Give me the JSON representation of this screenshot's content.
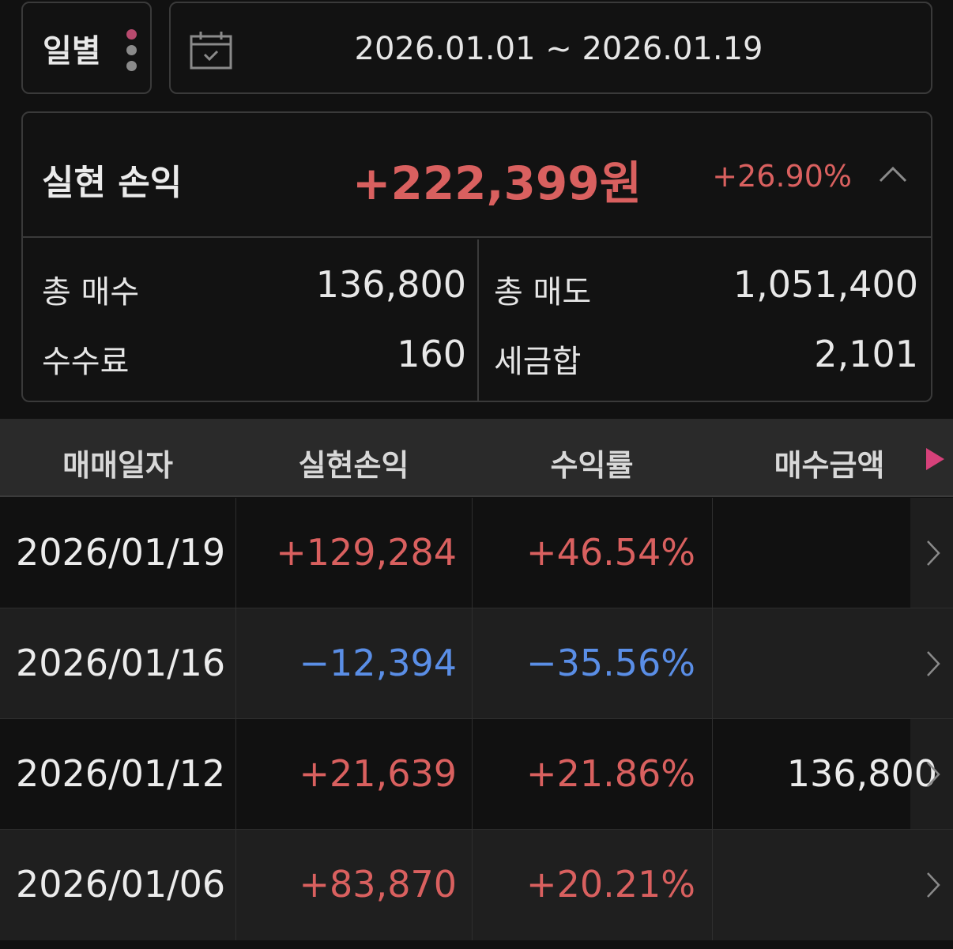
{
  "period": {
    "label": "일별"
  },
  "date_range": {
    "text": "2026.01.01 ~ 2026.01.19"
  },
  "summary": {
    "title": "실현 손익",
    "amount": "+222,399원",
    "rate": "+26.90%",
    "total_buy_label": "총 매수",
    "total_buy": "136,800",
    "total_sell_label": "총 매도",
    "total_sell": "1,051,400",
    "fee_label": "수수료",
    "fee": "160",
    "tax_label": "세금합",
    "tax": "2,101"
  },
  "table": {
    "headers": [
      "매매일자",
      "실현손익",
      "수익률",
      "매수금액"
    ],
    "rows": [
      {
        "date": "2026/01/19",
        "profit": "+129,284",
        "rate": "+46.54%",
        "buy_amount": "",
        "sign": "pos"
      },
      {
        "date": "2026/01/16",
        "profit": "−12,394",
        "rate": "−35.56%",
        "buy_amount": "",
        "sign": "neg"
      },
      {
        "date": "2026/01/12",
        "profit": "+21,639",
        "rate": "+21.86%",
        "buy_amount": "136,800",
        "sign": "pos"
      },
      {
        "date": "2026/01/06",
        "profit": "+83,870",
        "rate": "+20.21%",
        "buy_amount": "",
        "sign": "pos"
      }
    ]
  },
  "colors": {
    "positive": "#d9605f",
    "negative": "#5a8ee6",
    "accent": "#d6417a",
    "background": "#111111"
  },
  "icons": {
    "period_menu": "vertical-dots-icon",
    "calendar": "calendar-check-icon",
    "collapse": "chevron-up-icon",
    "scroll_right": "triangle-right-icon",
    "row_detail": "chevron-right-icon"
  }
}
